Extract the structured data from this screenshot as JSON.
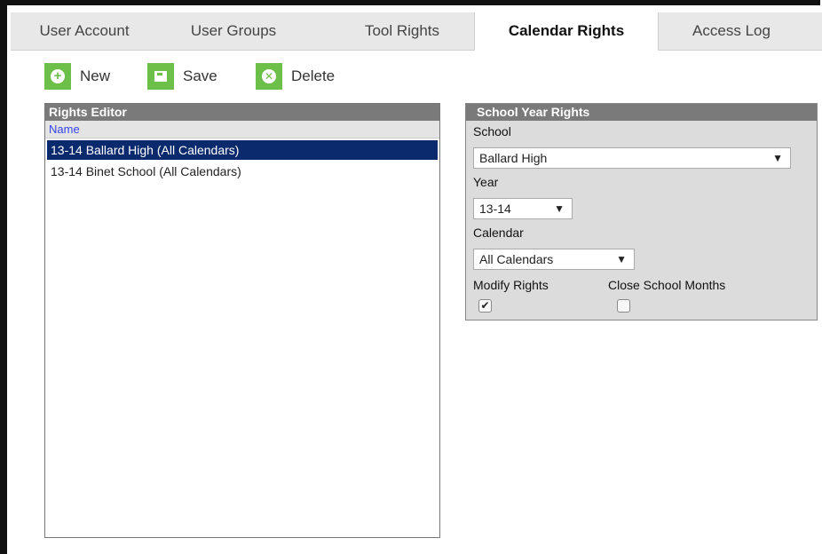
{
  "tabs": [
    {
      "label": "User Account"
    },
    {
      "label": "User Groups"
    },
    {
      "label": "Tool Rights"
    },
    {
      "label": "Calendar Rights",
      "active": true
    },
    {
      "label": "Access Log"
    }
  ],
  "toolbar": {
    "new_label": "New",
    "save_label": "Save",
    "delete_label": "Delete",
    "accent_color": "#6cc04a"
  },
  "rights_editor": {
    "title": "Rights Editor",
    "column_header": "Name",
    "rows": [
      {
        "label": "13-14 Ballard High (All Calendars)",
        "selected": true
      },
      {
        "label": "13-14 Binet School (All Calendars)",
        "selected": false
      }
    ]
  },
  "school_year_rights": {
    "title": "School Year Rights",
    "school_label": "School",
    "school_value": "Ballard High",
    "year_label": "Year",
    "year_value": "13-14",
    "calendar_label": "Calendar",
    "calendar_value": "All Calendars",
    "modify_rights_label": "Modify Rights",
    "modify_rights_checked": true,
    "close_months_label": "Close School Months",
    "close_months_checked": false
  }
}
